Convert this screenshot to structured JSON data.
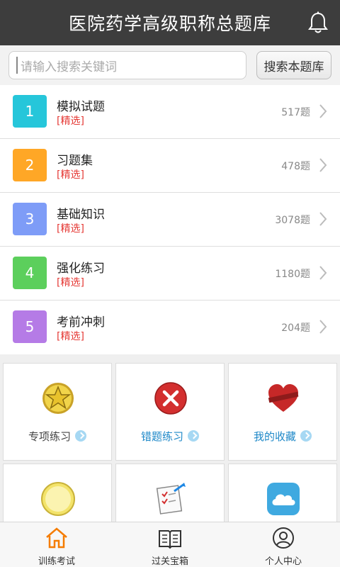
{
  "header": {
    "title": "医院药学高级职称总题库",
    "bell_icon": "bell-icon"
  },
  "search": {
    "placeholder": "请输入搜索关键词",
    "button_label": "搜索本题库"
  },
  "list": {
    "items": [
      {
        "num": "1",
        "name": "模拟试题",
        "tag": "[精选]",
        "count": "517题",
        "color": "#26c6da"
      },
      {
        "num": "2",
        "name": "习题集",
        "tag": "[精选]",
        "count": "478题",
        "color": "#ffa726"
      },
      {
        "num": "3",
        "name": "基础知识",
        "tag": "[精选]",
        "count": "3078题",
        "color": "#7e9cf7"
      },
      {
        "num": "4",
        "name": "强化练习",
        "tag": "[精选]",
        "count": "1180题",
        "color": "#5ccf5c"
      },
      {
        "num": "5",
        "name": "考前冲刺",
        "tag": "[精选]",
        "count": "204题",
        "color": "#b57be6"
      }
    ]
  },
  "grid": {
    "cells": [
      {
        "label": "专项练习",
        "icon": "star-medal-icon"
      },
      {
        "label": "错题练习",
        "icon": "error-x-icon"
      },
      {
        "label": "我的收藏",
        "icon": "heart-icon"
      },
      {
        "label": "",
        "icon": "notepad-icon"
      },
      {
        "label": "",
        "icon": "checklist-icon"
      },
      {
        "label": "",
        "icon": "cloud-icon"
      }
    ]
  },
  "tabbar": {
    "tabs": [
      {
        "label": "训练考试",
        "icon": "home-icon",
        "active": true
      },
      {
        "label": "过关宝箱",
        "icon": "book-icon"
      },
      {
        "label": "个人中心",
        "icon": "user-icon"
      }
    ]
  },
  "colors": {
    "header_bg": "#3d3d3d",
    "accent_orange": "#f57c00",
    "tag_red": "#e53935",
    "link_blue": "#1e88c8"
  }
}
